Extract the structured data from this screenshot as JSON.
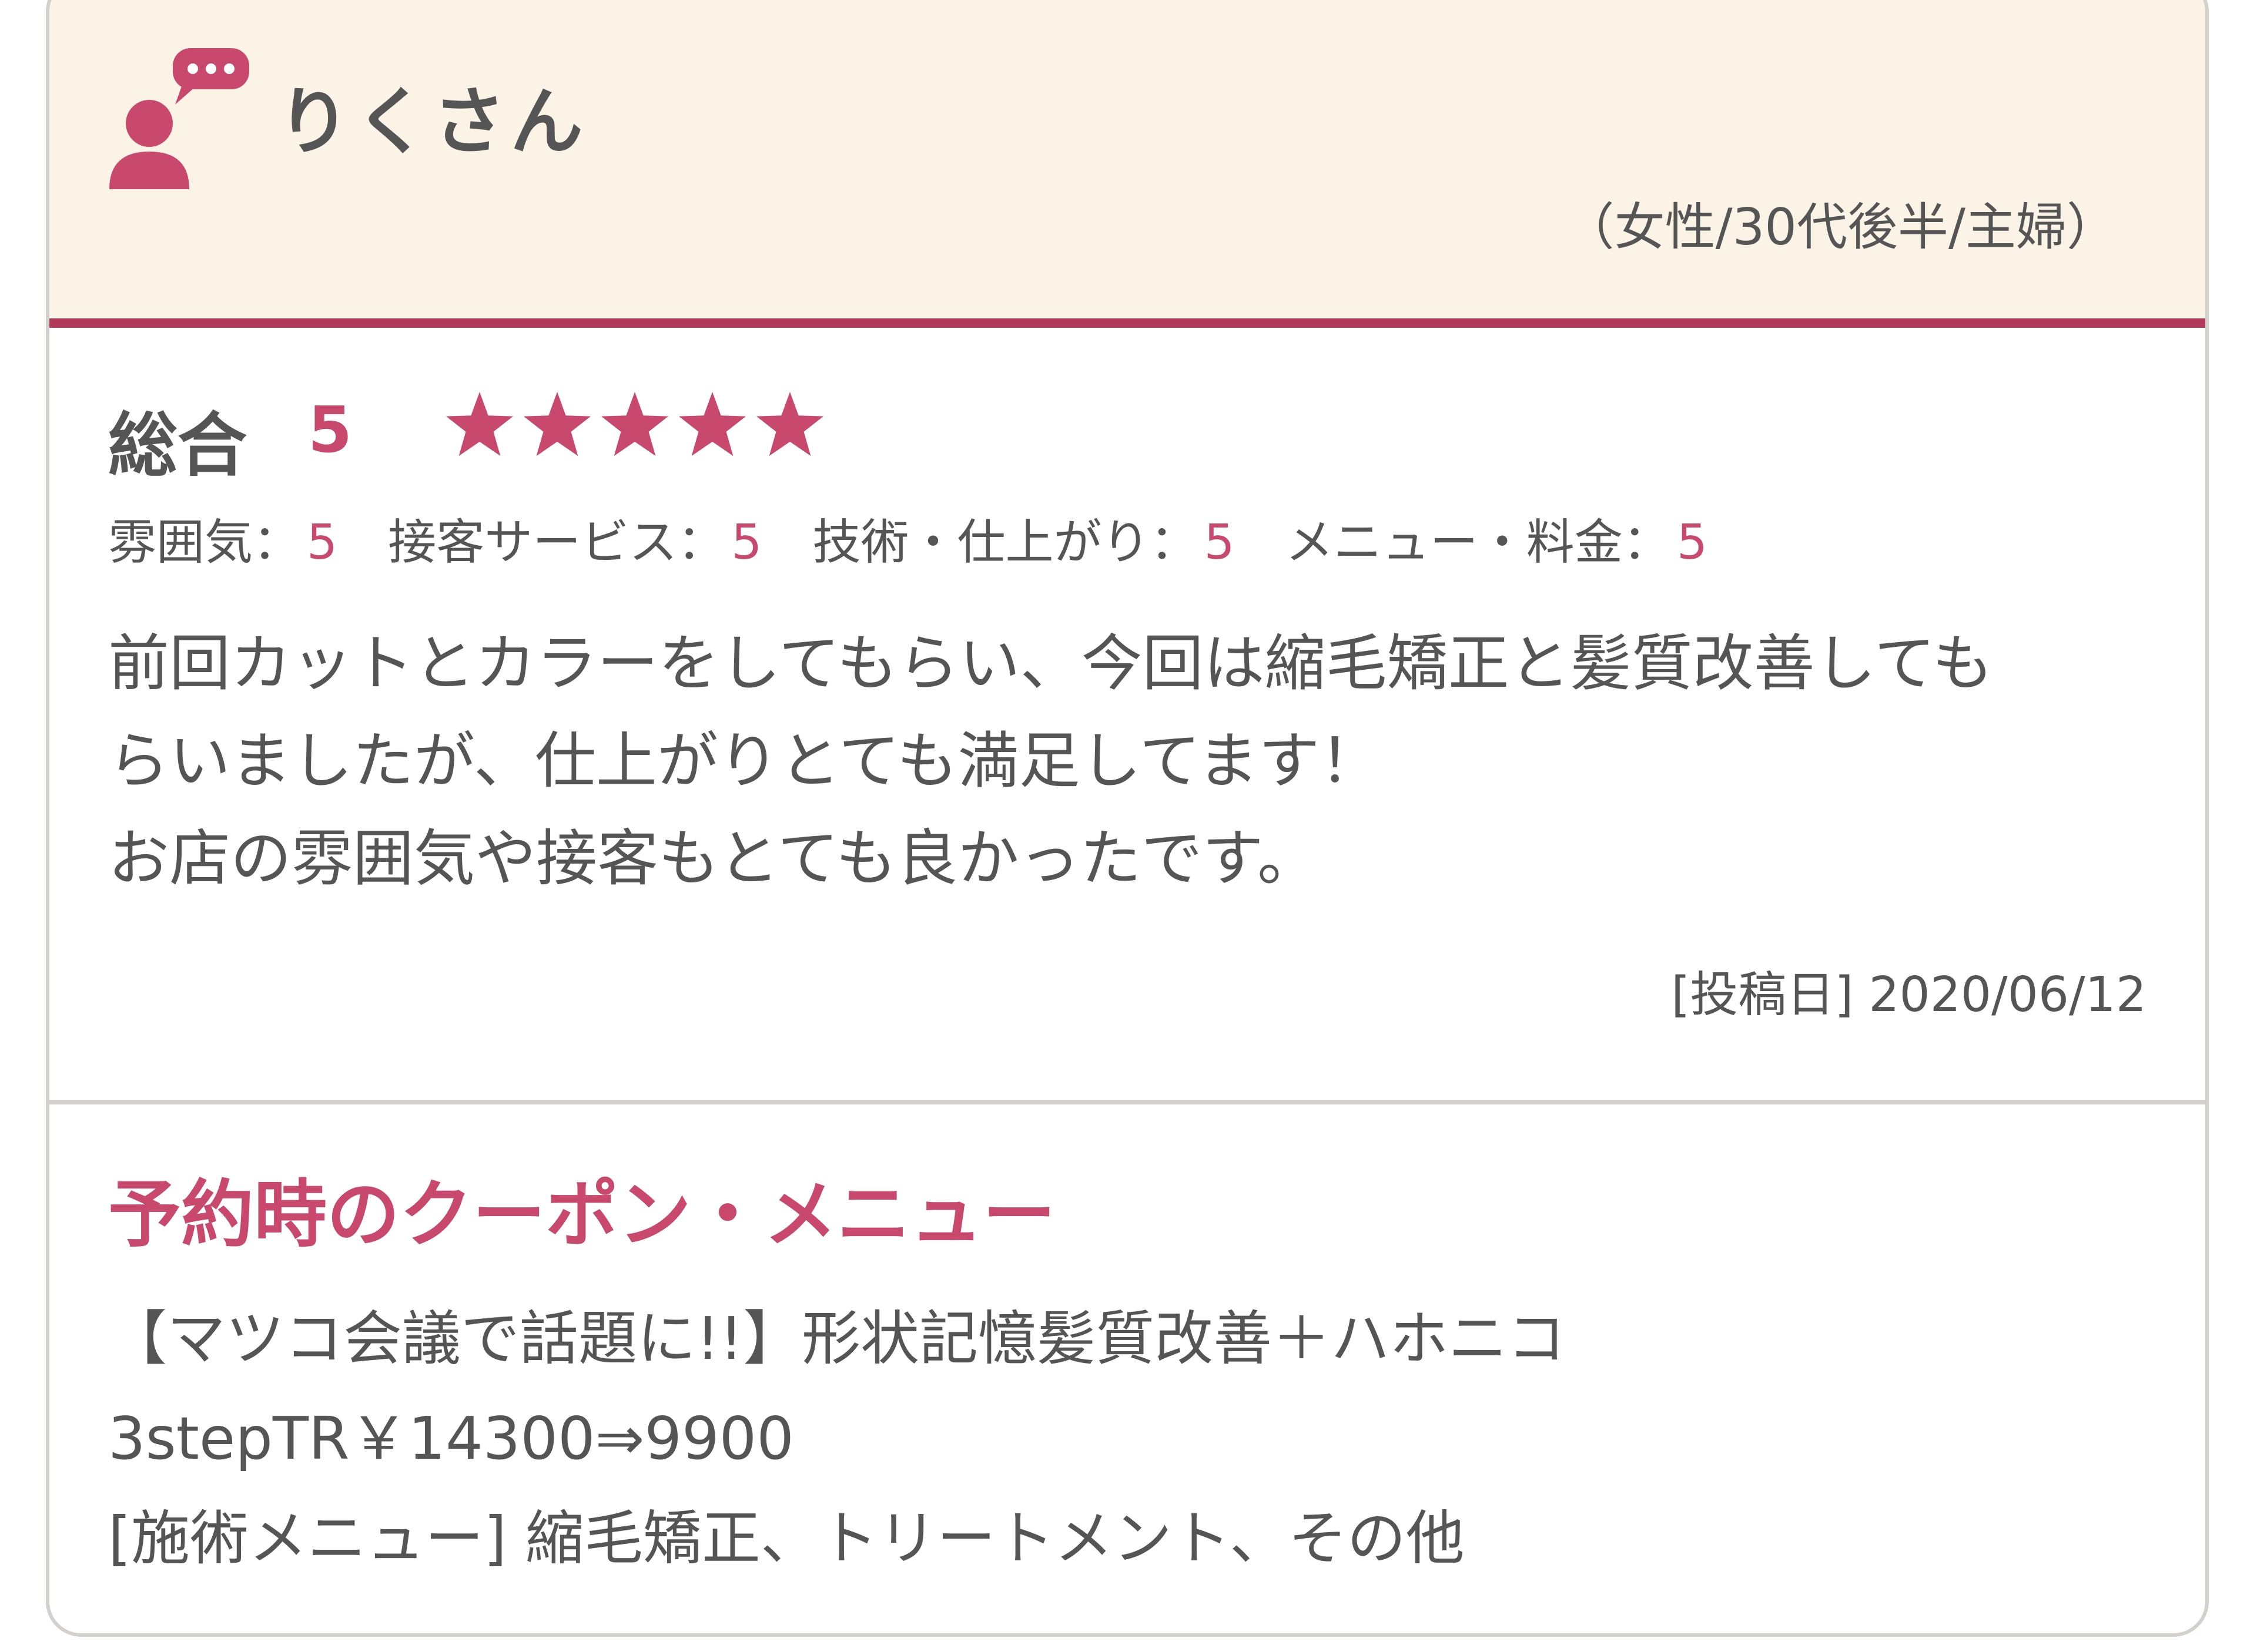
{
  "reviewer": {
    "name": "りくさん",
    "meta": "（女性/30代後半/主婦）",
    "icon": "user-comment-icon"
  },
  "rating": {
    "overall_label": "総合",
    "overall_score": "5",
    "stars": 5,
    "stars_max": 5,
    "sub": [
      {
        "label": "雰囲気：",
        "score": "5"
      },
      {
        "label": "接客サービス：",
        "score": "5"
      },
      {
        "label": "技術・仕上がり：",
        "score": "5"
      },
      {
        "label": "メニュー・料金：",
        "score": "5"
      }
    ]
  },
  "review": {
    "lines": [
      "前回カットとカラーをしてもらい、今回は縮毛矯正と髪質改善しても",
      "らいましたが、仕上がりとても満足してます！",
      "お店の雰囲気や接客もとても良かったです。"
    ],
    "post_date": "[投稿日] 2020/06/12"
  },
  "coupon": {
    "title": "予約時のクーポン・メニュー",
    "lines": [
      "【マツコ会議で話題に!!】形状記憶髪質改善＋ハホニコ",
      "3stepTR￥14300⇒9900",
      "[施術メニュー] 縮毛矯正、トリートメント、その他"
    ]
  },
  "colors": {
    "accent": "#c8496d",
    "header_bg": "#faf3e6",
    "header_border": "#b13a5c",
    "text": "#555555"
  }
}
